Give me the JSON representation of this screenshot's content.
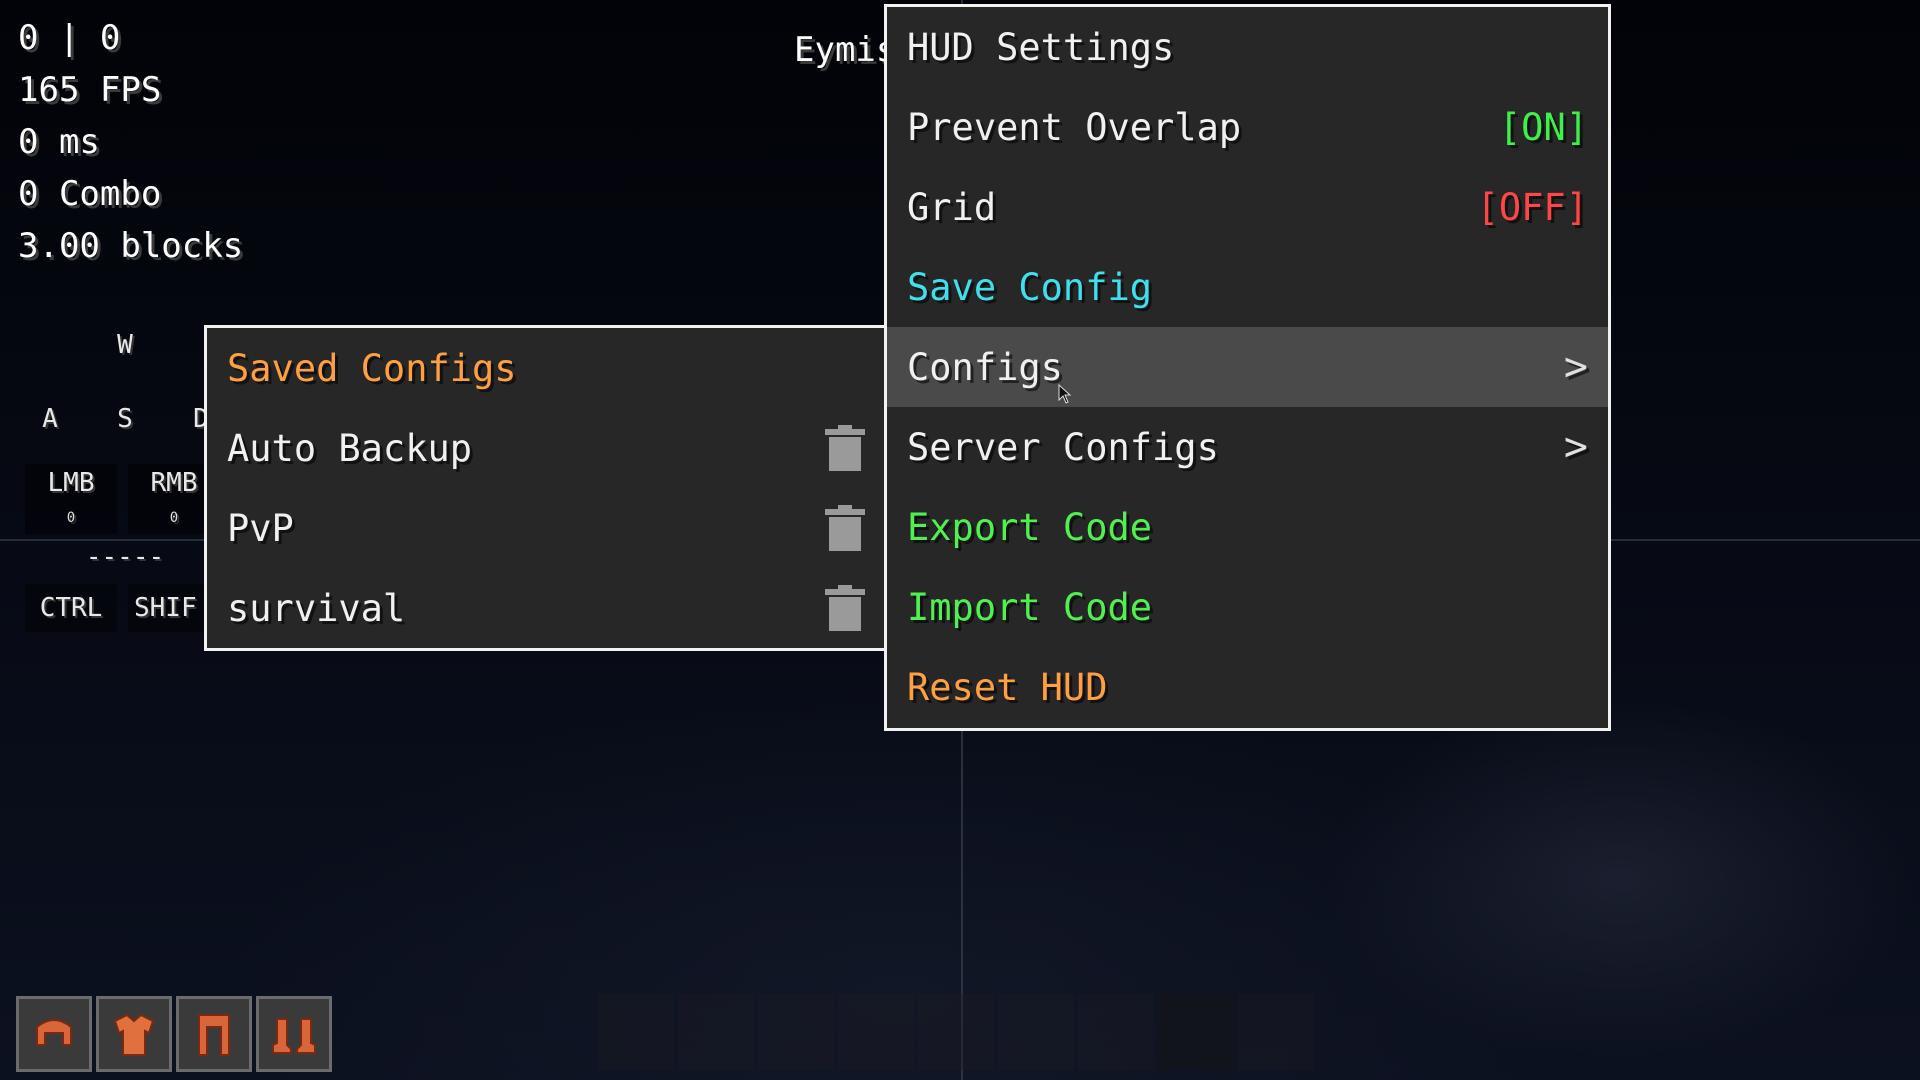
{
  "hud": {
    "stats": [
      "0 | 0",
      "165 FPS",
      "0 ms",
      "0 Combo",
      "3.00 blocks"
    ],
    "player_name": "Eymis"
  },
  "keystrokes": {
    "w": "W",
    "a": "A",
    "s": "S",
    "d": "D",
    "lmb": "LMB",
    "rmb": "RMB",
    "lmb_count": "0",
    "rmb_count": "0",
    "space": "-----",
    "ctrl": "CTRL",
    "shift": "SHIF"
  },
  "main_menu": {
    "title": "HUD Settings",
    "prevent_overlap": {
      "label": "Prevent Overlap",
      "state": "[ON]"
    },
    "grid": {
      "label": "Grid",
      "state": "[OFF]"
    },
    "save_config": "Save Config",
    "configs": "Configs",
    "server_configs": "Server Configs",
    "export_code": "Export Code",
    "import_code": "Import Code",
    "reset_hud": "Reset HUD",
    "submenu_chevron": ">"
  },
  "configs_submenu": {
    "title": "Saved Configs",
    "items": [
      {
        "label": "Auto Backup",
        "icon": "trash-icon"
      },
      {
        "label": "PvP",
        "icon": "trash-icon"
      },
      {
        "label": "survival",
        "icon": "trash-icon"
      }
    ]
  },
  "armor_slots": [
    "helmet-icon",
    "chestplate-icon",
    "leggings-icon",
    "boots-icon"
  ],
  "colors": {
    "on": "#3ef04a",
    "off": "#ff4545",
    "cyan": "#3fe0ee",
    "green": "#4ff04f",
    "orange": "#ffa040",
    "menu_bg": "#272727"
  }
}
